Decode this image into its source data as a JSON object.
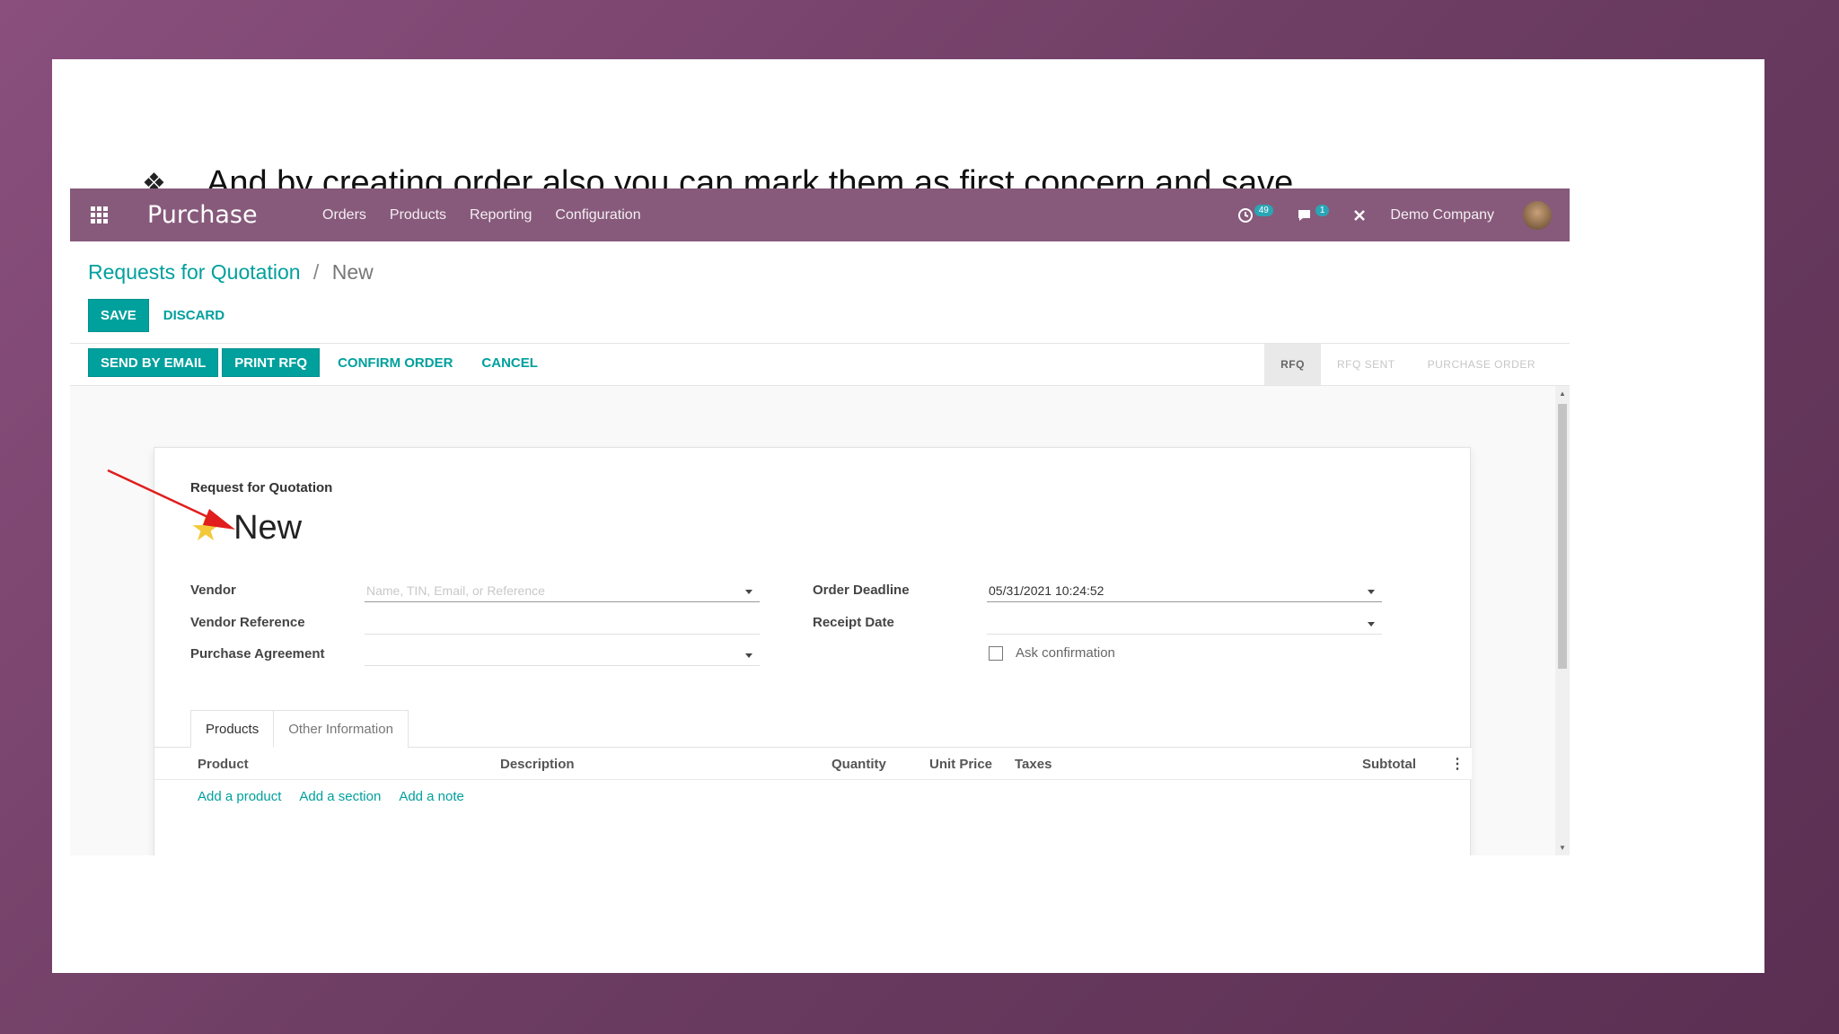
{
  "slide": {
    "bullet_symbol": "❖",
    "bullet_text": "And by creating order also you can mark them as first concern and save."
  },
  "navbar": {
    "app_name": "Purchase",
    "menu": [
      "Orders",
      "Products",
      "Reporting",
      "Configuration"
    ],
    "activity_badge": "49",
    "messages_badge": "1",
    "company": "Demo Company"
  },
  "breadcrumb": {
    "parent": "Requests for Quotation",
    "separator": "/",
    "current": "New"
  },
  "buttons": {
    "save": "SAVE",
    "discard": "DISCARD",
    "send_by_email": "SEND BY EMAIL",
    "print_rfq": "PRINT RFQ",
    "confirm_order": "CONFIRM ORDER",
    "cancel": "CANCEL"
  },
  "stages": [
    {
      "label": "RFQ",
      "active": true
    },
    {
      "label": "RFQ SENT",
      "active": false
    },
    {
      "label": "PURCHASE ORDER",
      "active": false
    }
  ],
  "form": {
    "doc_label": "Request for Quotation",
    "title": "New",
    "star_icon": "star-icon",
    "star_color": "#f3c93b",
    "vendor_label": "Vendor",
    "vendor_placeholder": "Name, TIN, Email, or Reference",
    "vendor_reference_label": "Vendor Reference",
    "purchase_agreement_label": "Purchase Agreement",
    "order_deadline_label": "Order Deadline",
    "order_deadline_value": "05/31/2021 10:24:52",
    "receipt_date_label": "Receipt Date",
    "ask_confirmation_label": "Ask confirmation"
  },
  "tabs": [
    "Products",
    "Other Information"
  ],
  "table": {
    "columns": [
      "Product",
      "Description",
      "Quantity",
      "Unit Price",
      "Taxes",
      "Subtotal"
    ],
    "add_links": [
      "Add a product",
      "Add a section",
      "Add a note"
    ]
  },
  "colors": {
    "navbar": "#875a7b",
    "accent": "#00a09d",
    "annotation_arrow": "#e11d1d"
  }
}
